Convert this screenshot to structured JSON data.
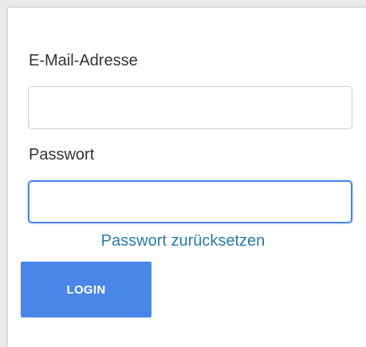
{
  "form": {
    "email_label": "E-Mail-Adresse",
    "email_value": "",
    "password_label": "Passwort",
    "password_value": "",
    "reset_link": "Passwort zurücksetzen",
    "login_button": "LOGIN"
  },
  "colors": {
    "accent": "#4a86e8",
    "link": "#2a7aaa",
    "label_text": "#333333"
  }
}
